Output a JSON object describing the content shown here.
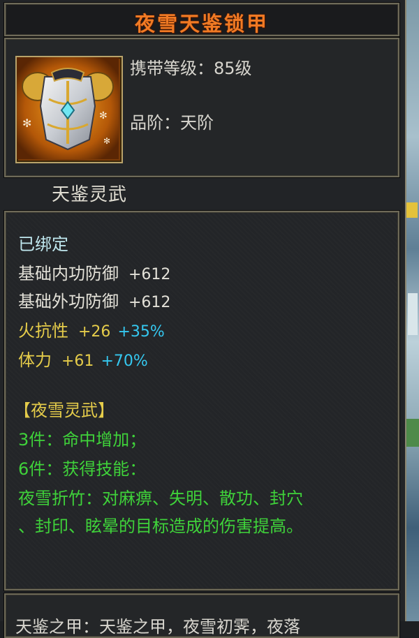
{
  "item": {
    "name": "夜雪天鉴锁甲",
    "level_label": "携带等级：85级",
    "grade_label": "品阶：天阶",
    "series": "天鉴灵武",
    "icon": "armor-chestplate-icon"
  },
  "stats": {
    "bound": "已绑定",
    "lines": [
      {
        "label": "基础内功防御",
        "value": "+612",
        "bonus": ""
      },
      {
        "label": "基础外功防御",
        "value": "+612",
        "bonus": ""
      },
      {
        "label": "火抗性",
        "value": "+26",
        "bonus": "+35%"
      },
      {
        "label": "体力",
        "value": "+61",
        "bonus": "+70%"
      }
    ]
  },
  "set": {
    "title": "【夜雪灵武】",
    "bonus_3": "3件：命中增加；",
    "bonus_6": "6件：获得技能：",
    "skill_line1": "夜雪折竹：对麻痹、失明、散功、封穴",
    "skill_line2": "、封印、眩晕的目标造成的伤害提高。"
  },
  "footer": {
    "text": "天鉴之甲：天鉴之甲，夜雪初霁，夜落"
  },
  "colors": {
    "title": "#f07a24",
    "cyan": "#bfe7ee",
    "yellow": "#e5cc4a",
    "blue": "#35c8f0",
    "green": "#3fd23a",
    "border": "#6e6a58"
  }
}
